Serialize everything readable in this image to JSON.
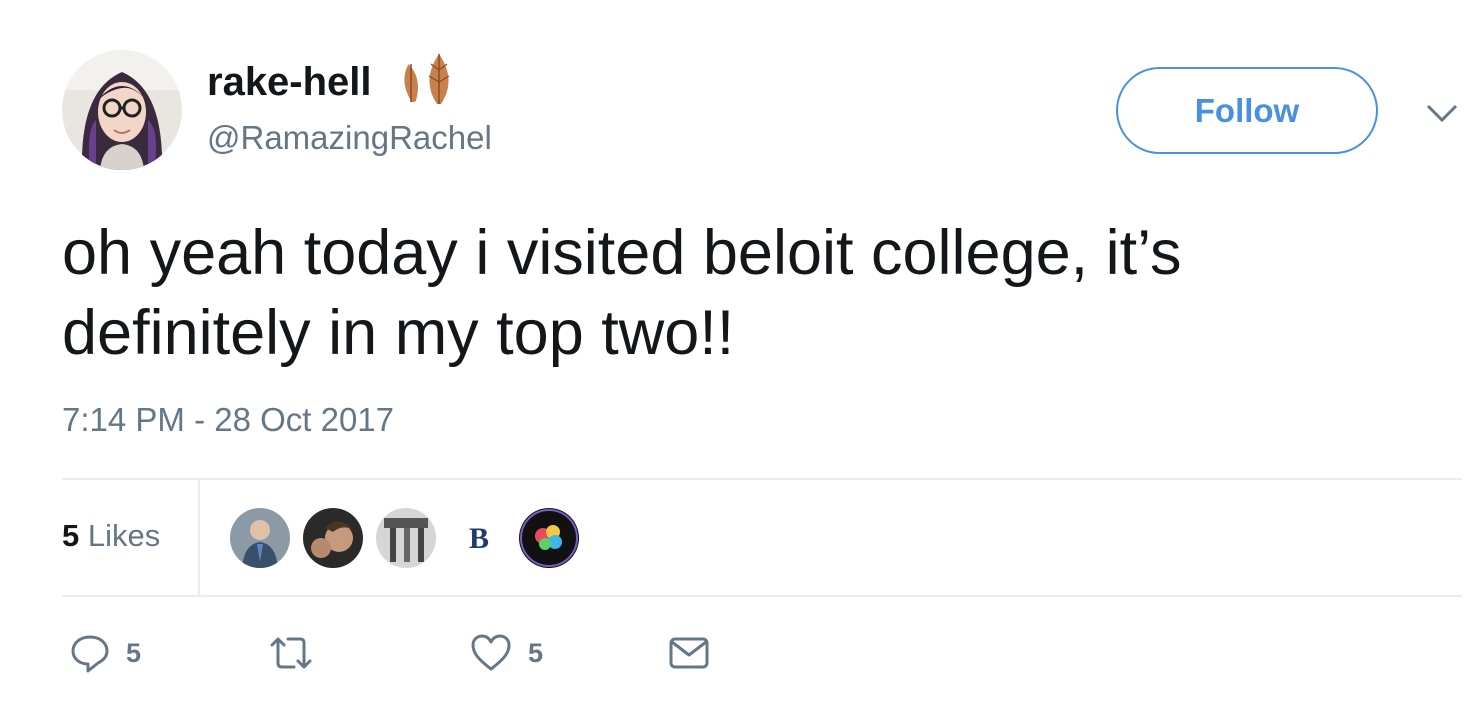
{
  "user": {
    "display_name": "rake-hell",
    "handle": "@RamazingRachel"
  },
  "follow_label": "Follow",
  "tweet": {
    "text": "oh yeah today i visited beloit college, it’s definitely in my top two!!",
    "timestamp": "7:14 PM - 28 Oct 2017"
  },
  "stats": {
    "likes_count": "5",
    "likes_label": "Likes"
  },
  "likers": [
    {
      "icon": "liker-avatar-1"
    },
    {
      "icon": "liker-avatar-2"
    },
    {
      "icon": "liker-avatar-3"
    },
    {
      "icon": "liker-avatar-beloit",
      "letter": "B"
    },
    {
      "icon": "liker-avatar-5"
    }
  ],
  "actions": {
    "reply_count": "5",
    "like_count": "5"
  },
  "colors": {
    "accent": "#4a90e2",
    "text": "#14171a",
    "muted": "#657786",
    "divider": "#e6ecf0"
  }
}
